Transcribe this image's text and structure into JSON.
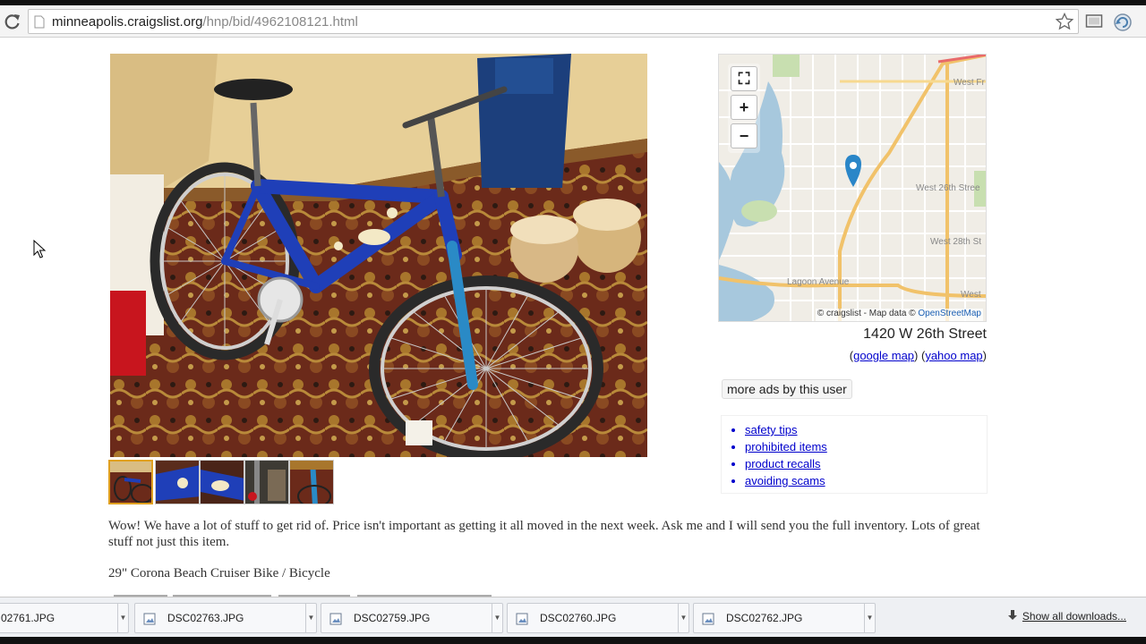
{
  "browser": {
    "url_host": "minneapolis.craigslist.org",
    "url_path": "/hnp/bid/4962108121.html"
  },
  "map": {
    "fullscreen_label": "⛶",
    "zoom_in_label": "+",
    "zoom_out_label": "−",
    "street_labels": [
      "West Fr",
      "West 26th Stree",
      "West 28th St",
      "Lagoon Avenue",
      "West"
    ],
    "attribution_prefix": "© craigslist - Map data ©",
    "attribution_link": "OpenStreetMap"
  },
  "listing": {
    "address": "1420 W 26th Street",
    "google_map": "google map",
    "yahoo_map": "yahoo map",
    "more_ads": "more ads by this user",
    "sidebar_links": [
      "safety tips",
      "prohibited items",
      "product recalls",
      "avoiding scams"
    ],
    "body_text": "Wow! We have a lot of stuff to get rid of. Price isn't important as getting it all moved in the next week. Ask me and I will send you the full inventory. Lots of great stuff not just this item.",
    "item_title": "29\" Corona Beach Cruiser Bike / Bicycle"
  },
  "downloads": {
    "items": [
      "02761.JPG",
      "DSC02763.JPG",
      "DSC02759.JPG",
      "DSC02760.JPG",
      "DSC02762.JPG"
    ],
    "show_all": "Show all downloads..."
  },
  "colors": {
    "link": "#0000cc",
    "bike_blue": "#1f3fb8",
    "carpet": "#6b2a1a"
  }
}
